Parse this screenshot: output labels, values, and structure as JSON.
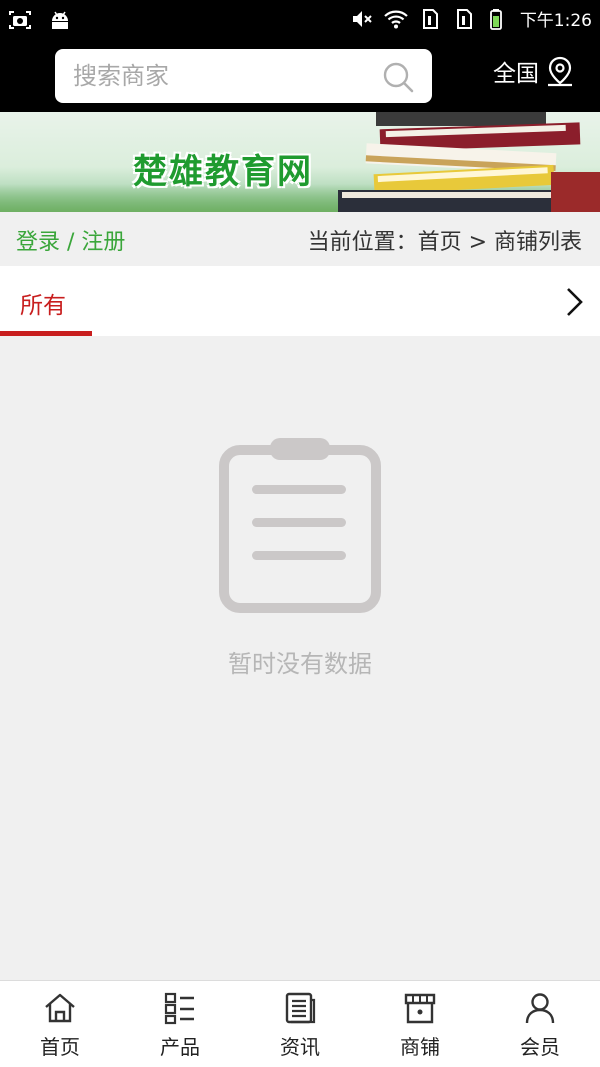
{
  "status_bar": {
    "time": "下午1:26",
    "icons": [
      "screenshot-icon",
      "android-icon",
      "mute-icon",
      "wifi-icon",
      "sim1-icon",
      "sim2-icon",
      "battery-icon"
    ]
  },
  "search": {
    "placeholder": "搜索商家",
    "region_label": "全国"
  },
  "banner": {
    "title": "楚雄教育网"
  },
  "breadcrumb": {
    "login_label": "登录 / 注册",
    "location_label": "当前位置：首页 > 商铺列表"
  },
  "tabs": {
    "active_label": "所有"
  },
  "empty_state": {
    "message": "暂时没有数据"
  },
  "bottom_nav": [
    {
      "label": "首页",
      "icon": "home-icon"
    },
    {
      "label": "产品",
      "icon": "grid-list-icon"
    },
    {
      "label": "资讯",
      "icon": "news-icon"
    },
    {
      "label": "商铺",
      "icon": "store-icon"
    },
    {
      "label": "会员",
      "icon": "user-icon"
    }
  ],
  "colors": {
    "accent": "#c81e1e",
    "login_green": "#3aa63a",
    "topbar": "#000000"
  }
}
